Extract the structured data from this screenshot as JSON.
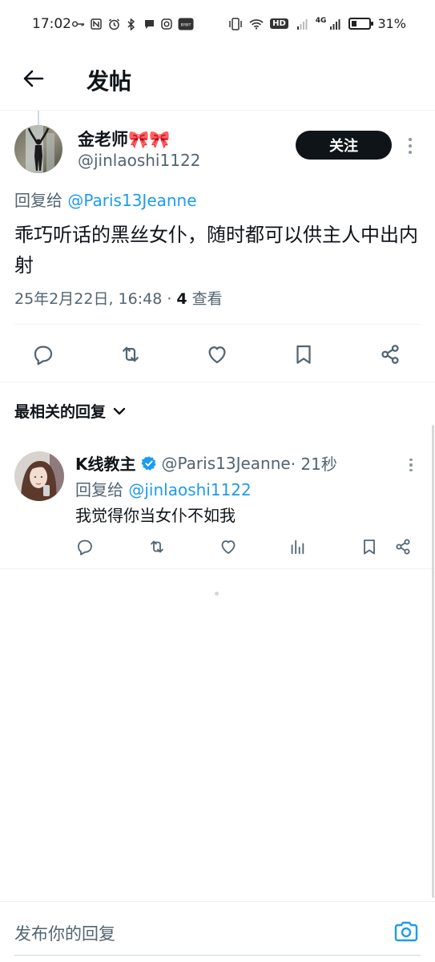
{
  "status_bar": {
    "time": "17:02",
    "network_label": "HD",
    "signal_label": "4G",
    "battery_percent": "31%",
    "battery_level": 0.31,
    "left_icons": [
      "key-icon",
      "nfc-icon",
      "alarm-icon",
      "bluetooth-icon",
      "chat-bubble-icon",
      "instagram-icon",
      "app-badge-icon"
    ],
    "left_badge": "BYBIT"
  },
  "header": {
    "title": "发帖",
    "back_icon": "arrow-left-icon"
  },
  "post": {
    "author_name": "金老师🎀🎀",
    "author_handle": "@jinlaoshi1122",
    "follow_label": "关注",
    "replying_prefix": "回复给 ",
    "replying_to": "@Paris13Jeanne",
    "text": "乖巧听话的黑丝女仆，随时都可以供主人中出内射",
    "meta_datetime": "25年2月22日, 16:48 · ",
    "meta_views_count": "4",
    "meta_views_label": " 查看",
    "actions": [
      "reply-icon",
      "retweet-icon",
      "like-icon",
      "bookmark-icon",
      "share-icon"
    ]
  },
  "replies_section": {
    "sort_label": "最相关的回复"
  },
  "reply": {
    "author_name": "K线教主",
    "author_handle": "@Paris13Jeanne",
    "time": " · 21秒",
    "replying_prefix": "回复给 ",
    "replying_to": "@jinlaoshi1122",
    "text": "我觉得你当女仆不如我",
    "actions": [
      "reply-icon",
      "retweet-icon",
      "like-icon",
      "views-icon",
      "bookmark-icon",
      "share-icon"
    ]
  },
  "compose": {
    "placeholder": "发布你的回复"
  },
  "colors": {
    "accent": "#1d9bf0",
    "text_primary": "#0f1419",
    "text_secondary": "#536471",
    "follow_button_bg": "#0f1419"
  }
}
